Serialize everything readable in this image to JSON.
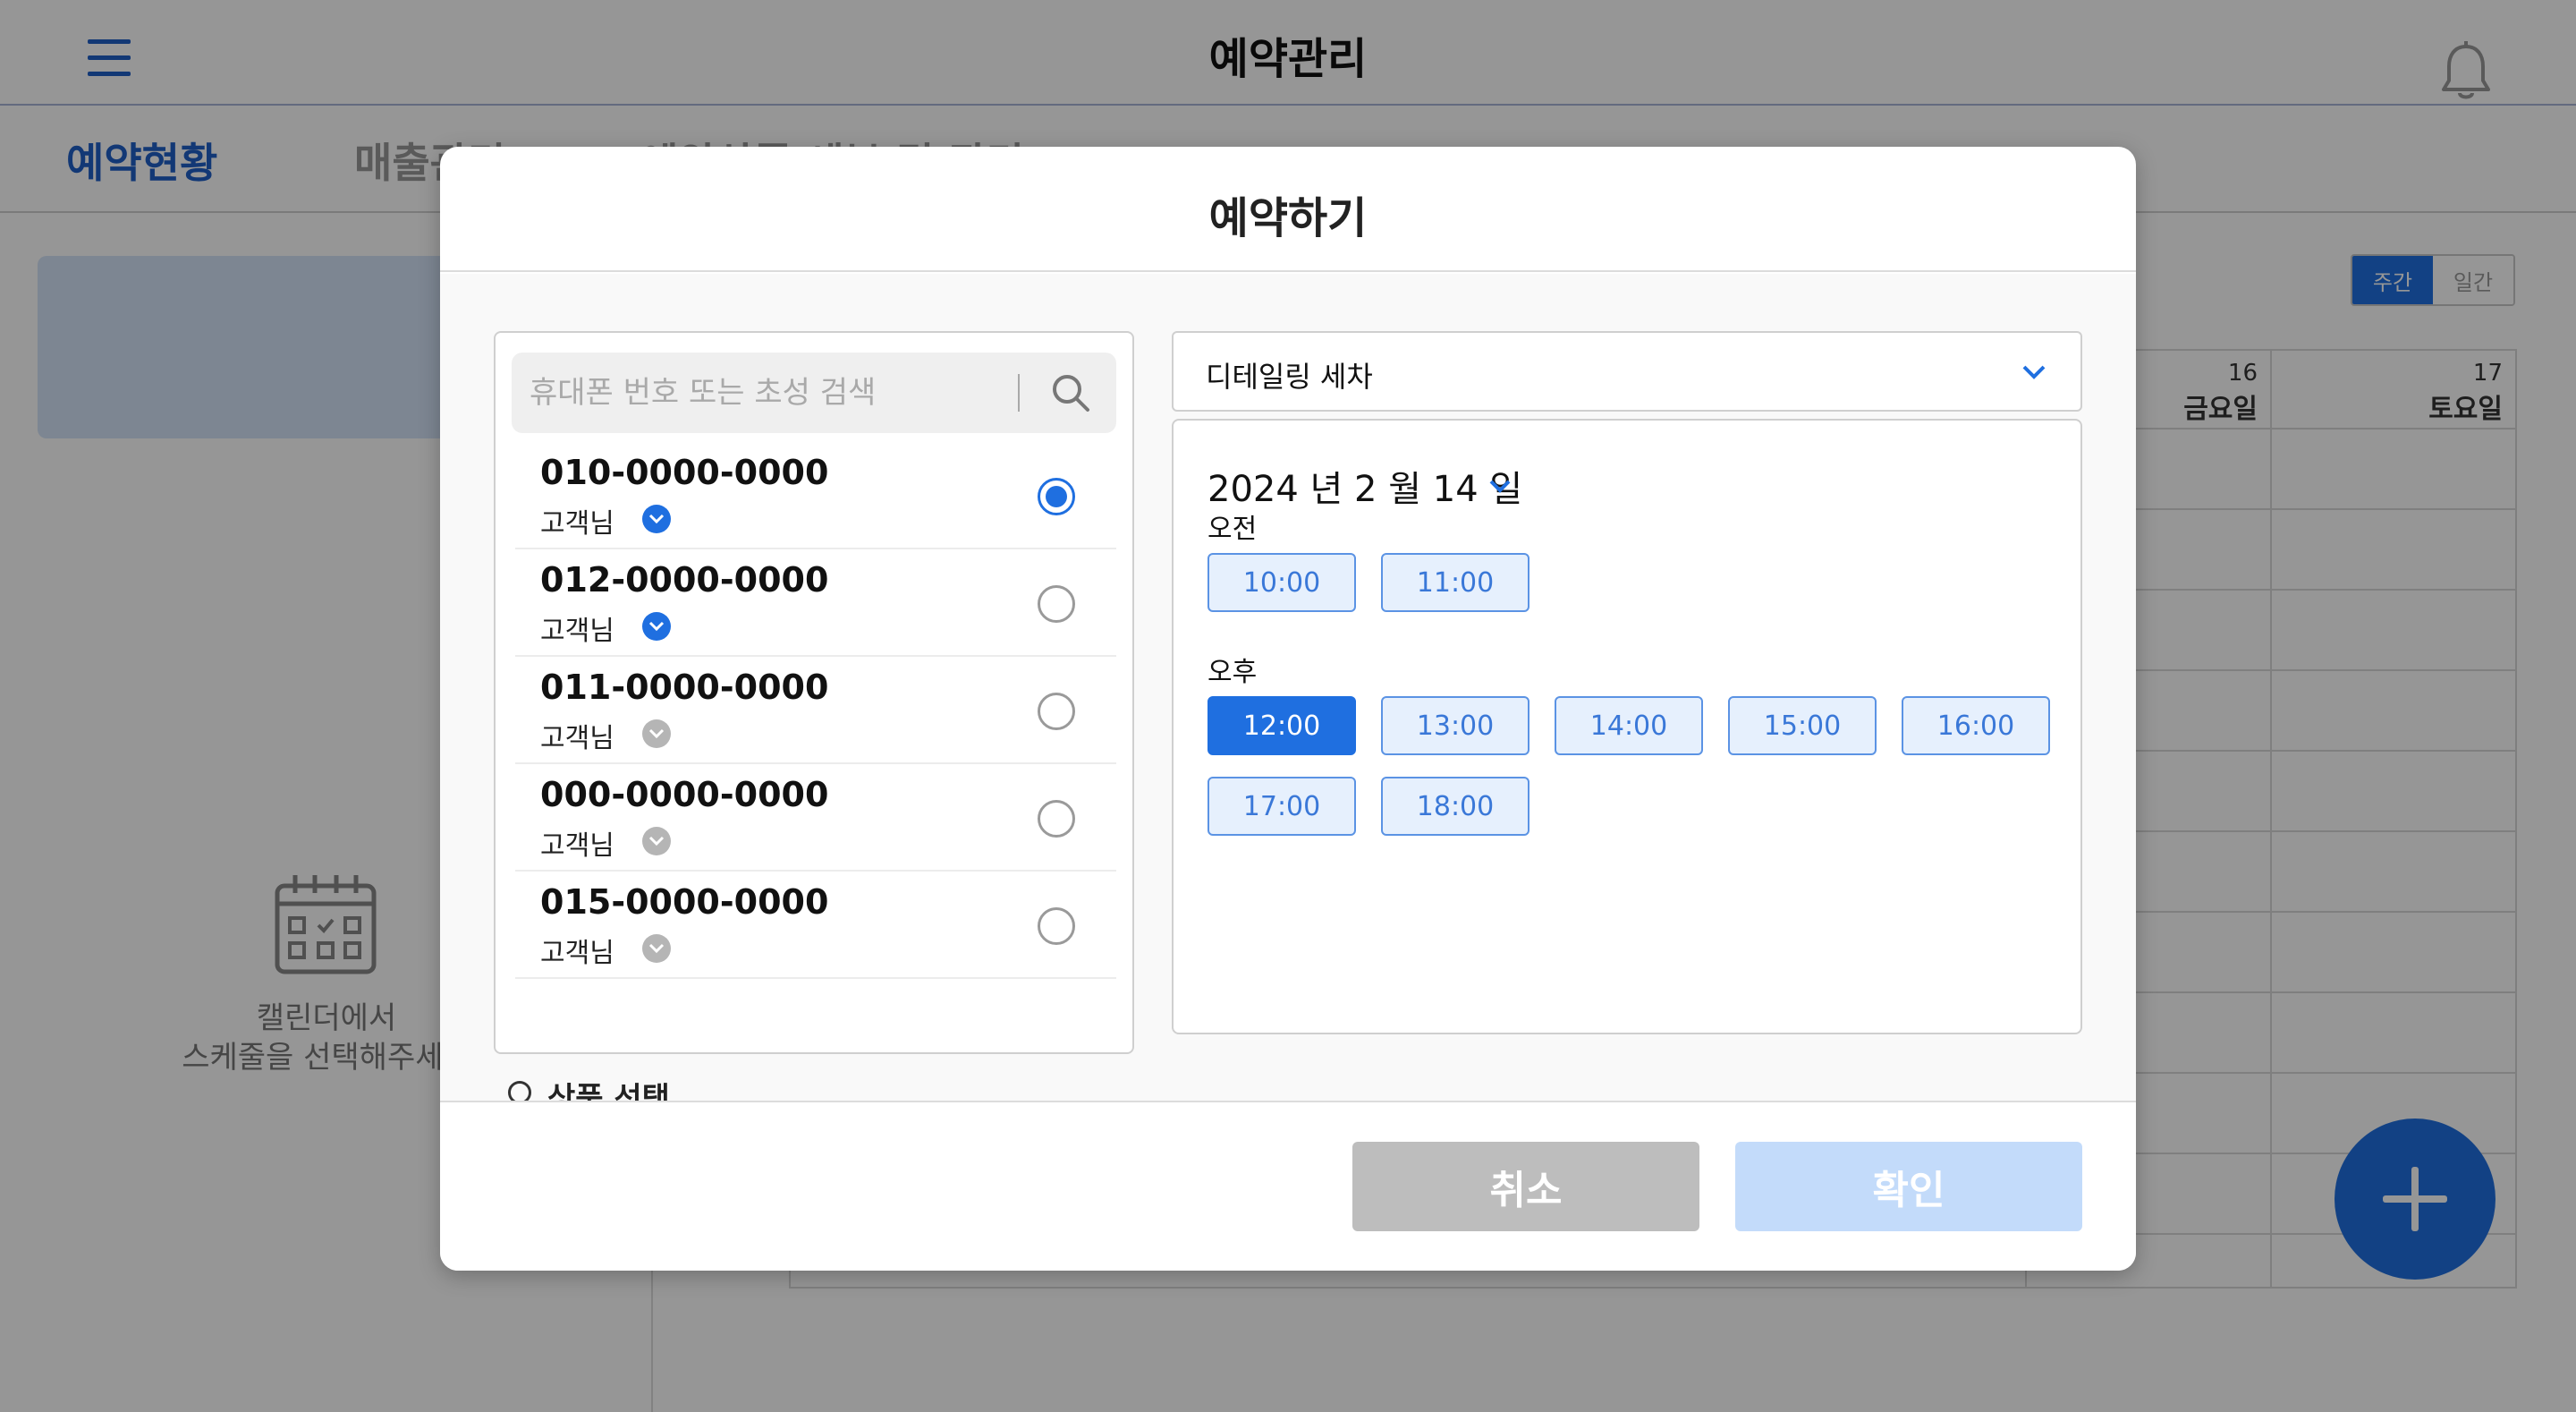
{
  "header": {
    "title": "예약관리",
    "menu_icon": "menu-icon",
    "bell_icon": "bell-icon"
  },
  "nav": {
    "tabs": [
      {
        "label": "예약현황",
        "active": true
      },
      {
        "label": "매출관리",
        "active": false
      },
      {
        "label": "예약상품 세부 및 관리",
        "active": false
      }
    ]
  },
  "sidebar": {
    "empty_line1": "캘린더에서",
    "empty_line2": "스케줄을 선택해주세요"
  },
  "view_toggle": {
    "week": "주간",
    "day": "일간"
  },
  "calendar": {
    "days": [
      {
        "date": "16",
        "weekday": "금요일"
      },
      {
        "date": "17",
        "weekday": "토요일"
      }
    ]
  },
  "modal": {
    "title": "예약하기",
    "search": {
      "placeholder": "휴대폰 번호 또는 초성 검색"
    },
    "customers": [
      {
        "phone": "010-0000-0000",
        "label": "고객님",
        "verified": true,
        "selected": true
      },
      {
        "phone": "012-0000-0000",
        "label": "고객님",
        "verified": true,
        "selected": false
      },
      {
        "phone": "011-0000-0000",
        "label": "고객님",
        "verified": false,
        "selected": false
      },
      {
        "phone": "000-0000-0000",
        "label": "고객님",
        "verified": false,
        "selected": false
      },
      {
        "phone": "015-0000-0000",
        "label": "고객님",
        "verified": false,
        "selected": false
      }
    ],
    "service": {
      "selected": "디테일링 세차"
    },
    "date": {
      "year": "2024",
      "year_unit": "년",
      "month": "2",
      "month_unit": "월",
      "day": "14",
      "day_unit": "일"
    },
    "morning": {
      "label": "오전",
      "slots": [
        "10:00",
        "11:00"
      ]
    },
    "afternoon": {
      "label": "오후",
      "slots": [
        "12:00",
        "13:00",
        "14:00",
        "15:00",
        "16:00",
        "17:00",
        "18:00"
      ],
      "selected": "12:00"
    },
    "next_section": "상품 선택",
    "cancel": "취소",
    "confirm": "확인"
  },
  "colors": {
    "primary": "#1f6fe0",
    "nav_active": "#1f5fc8",
    "slot_bg": "#e6f0fd",
    "cancel_bg": "#bdbdbd",
    "confirm_bg": "#c3dbfa"
  }
}
